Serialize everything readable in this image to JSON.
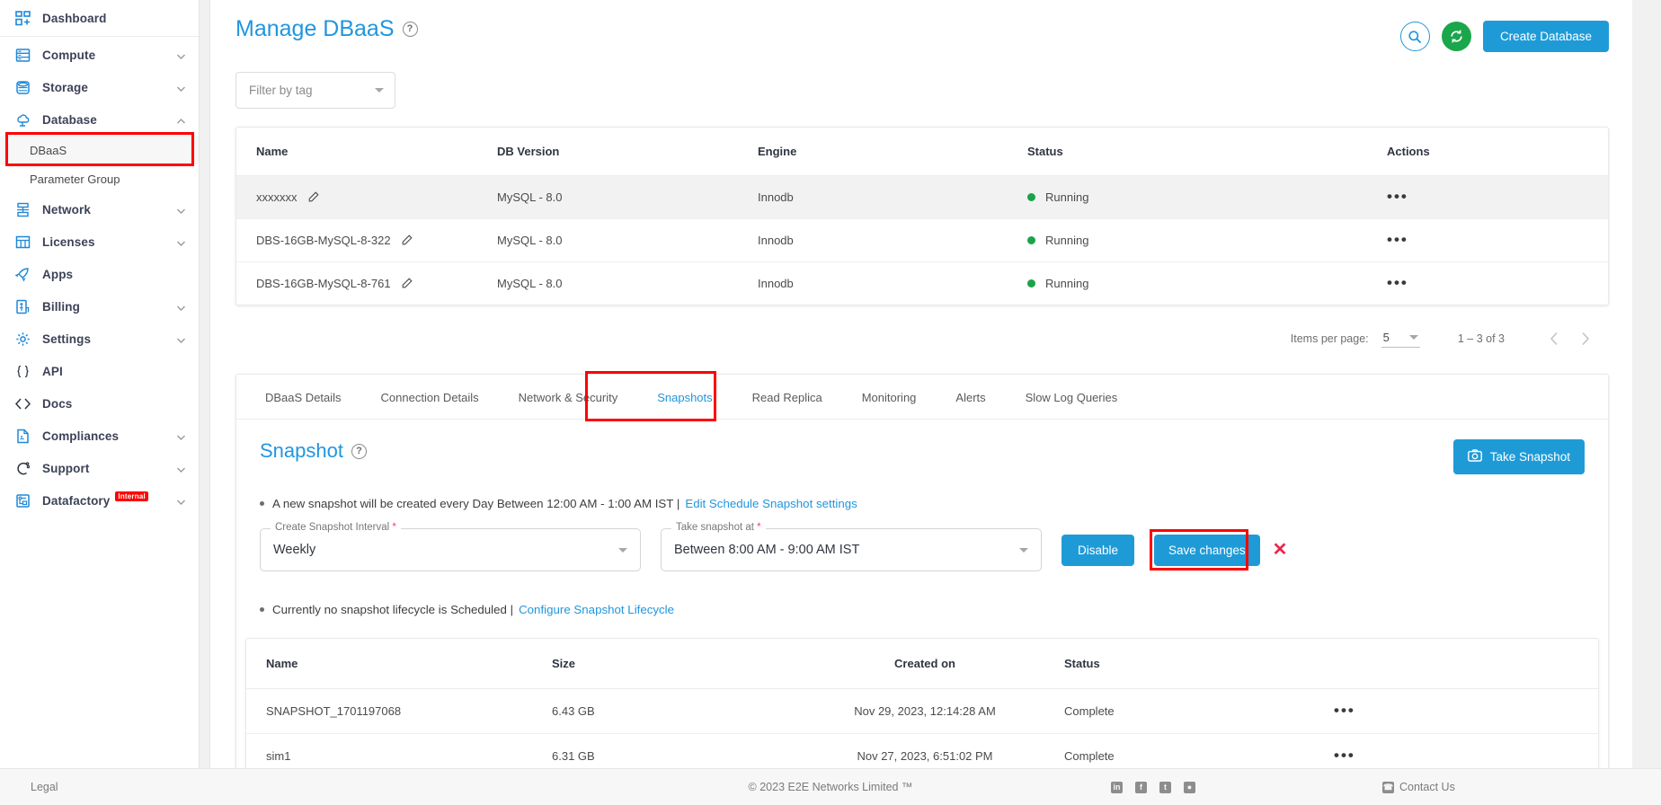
{
  "sidebar": {
    "items": [
      {
        "label": "Dashboard",
        "icon": "dashboard-icon",
        "expandable": false
      },
      {
        "label": "Compute",
        "icon": "server-icon",
        "expandable": true
      },
      {
        "label": "Storage",
        "icon": "database-cylinder-icon",
        "expandable": true
      },
      {
        "label": "Database",
        "icon": "cloud-database-icon",
        "expandable": true,
        "expanded": true
      },
      {
        "label": "Network",
        "icon": "network-icon",
        "expandable": true
      },
      {
        "label": "Licenses",
        "icon": "grid-icon",
        "expandable": true
      },
      {
        "label": "Apps",
        "icon": "rocket-icon",
        "expandable": false
      },
      {
        "label": "Billing",
        "icon": "billing-icon",
        "expandable": true
      },
      {
        "label": "Settings",
        "icon": "gear-icon",
        "expandable": true
      },
      {
        "label": "API",
        "icon": "braces-icon",
        "expandable": false
      },
      {
        "label": "Docs",
        "icon": "code-brackets-icon",
        "expandable": false
      },
      {
        "label": "Compliances",
        "icon": "document-icon",
        "expandable": true
      },
      {
        "label": "Support",
        "icon": "lifebuoy-icon",
        "expandable": true
      },
      {
        "label": "Datafactory",
        "icon": "datafactory-icon",
        "expandable": true,
        "badge": "Internal"
      }
    ],
    "sub_items": [
      {
        "label": "DBaaS",
        "active": true
      },
      {
        "label": "Parameter Group",
        "active": false
      }
    ]
  },
  "header": {
    "title": "Manage DBaaS",
    "help_icon": "question-mark-icon",
    "search_icon": "search-icon",
    "refresh_icon": "refresh-icon",
    "create_button": "Create Database"
  },
  "filter": {
    "placeholder": "Filter by tag",
    "caret_icon": "chevron-down-icon"
  },
  "db_table": {
    "columns": [
      "Name",
      "DB Version",
      "Engine",
      "Status",
      "Actions"
    ],
    "rows": [
      {
        "name": "xxxxxxx",
        "db_version": "MySQL - 8.0",
        "engine": "Innodb",
        "status": "Running",
        "actions": "•••"
      },
      {
        "name": "DBS-16GB-MySQL-8-322",
        "db_version": "MySQL - 8.0",
        "engine": "Innodb",
        "status": "Running",
        "actions": "•••"
      },
      {
        "name": "DBS-16GB-MySQL-8-761",
        "db_version": "MySQL - 8.0",
        "engine": "Innodb",
        "status": "Running",
        "actions": "•••"
      }
    ]
  },
  "paginator": {
    "items_per_page_label": "Items per page:",
    "items_per_page_value": "5",
    "range": "1 – 3 of 3",
    "prev_icon": "chevron-left-icon",
    "next_icon": "chevron-right-icon"
  },
  "tabs": [
    {
      "label": "DBaaS Details",
      "active": false
    },
    {
      "label": "Connection Details",
      "active": false
    },
    {
      "label": "Network & Security",
      "active": false
    },
    {
      "label": "Snapshots",
      "active": true
    },
    {
      "label": "Read Replica",
      "active": false
    },
    {
      "label": "Monitoring",
      "active": false
    },
    {
      "label": "Alerts",
      "active": false
    },
    {
      "label": "Slow Log Queries",
      "active": false
    }
  ],
  "snapshot": {
    "title": "Snapshot",
    "help_icon": "question-mark-icon",
    "take_snapshot_button": "Take Snapshot",
    "camera_icon": "camera-icon",
    "schedule_note": "A new snapshot will be created every Day Between 12:00 AM - 1:00 AM IST |",
    "schedule_link": "Edit Schedule Snapshot settings",
    "interval_label": "Create Snapshot Interval",
    "interval_value": "Weekly",
    "time_label": "Take snapshot at",
    "time_value": "Between 8:00 AM - 9:00 AM IST",
    "disable_button": "Disable",
    "save_button": "Save changes",
    "close_icon": "red-x-icon",
    "lifecycle_note": "Currently no snapshot lifecycle is Scheduled |",
    "lifecycle_link": "Configure Snapshot Lifecycle"
  },
  "snapshot_table": {
    "columns": [
      "Name",
      "Size",
      "Created on",
      "Status"
    ],
    "rows": [
      {
        "name": "SNAPSHOT_1701197068",
        "size": "6.43 GB",
        "created_on": "Nov 29, 2023, 12:14:28 AM",
        "status": "Complete",
        "actions": "•••"
      },
      {
        "name": "sim1",
        "size": "6.31 GB",
        "created_on": "Nov 27, 2023, 6:51:02 PM",
        "status": "Complete",
        "actions": "•••"
      }
    ]
  },
  "footer": {
    "legal": "Legal",
    "copyright": "© 2023 E2E Networks Limited ™",
    "social": [
      {
        "icon": "linkedin-icon",
        "glyph": "in"
      },
      {
        "icon": "facebook-icon",
        "glyph": "f"
      },
      {
        "icon": "twitter-icon",
        "glyph": "t"
      },
      {
        "icon": "rss-icon",
        "glyph": "●"
      }
    ],
    "contact": "Contact Us",
    "contact_icon": "phone-icon"
  },
  "colors": {
    "accent_blue": "#2196dd",
    "button_blue": "#1e9bd7",
    "status_green": "#19a449",
    "refresh_green": "#1aa64b",
    "highlight_red": "#ff0000",
    "close_red": "#e8274b",
    "badge_red": "#ff0000"
  }
}
